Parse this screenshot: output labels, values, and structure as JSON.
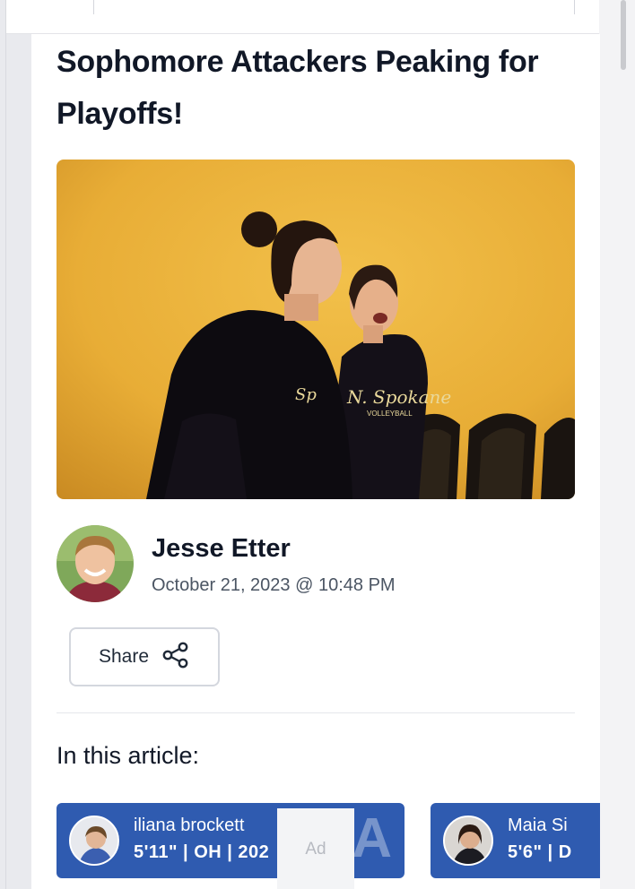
{
  "article": {
    "title": "Sophomore Attackers Peaking for Playoffs!",
    "hero_image_icon": "volleyball-players-photo",
    "jersey_text": "N. Spokane",
    "jersey_subtext": "VOLLEYBALL"
  },
  "author": {
    "name": "Jesse Etter",
    "date": "October 21, 2023 @ 10:48 PM",
    "avatar_icon": "author-avatar"
  },
  "share": {
    "label": "Share",
    "icon": "share-icon"
  },
  "section": {
    "in_article_label": "In this article:"
  },
  "players": [
    {
      "name": "iliana brockett",
      "meta": "5'11\" | OH | 202",
      "letter": "A",
      "photo_icon": "player-photo"
    },
    {
      "name": "Maia Si",
      "meta": "5'6\" | D",
      "letter": "",
      "photo_icon": "player-photo"
    }
  ],
  "ad": {
    "label": "Ad"
  },
  "colors": {
    "accent": "#2f5bb0",
    "title": "#111827",
    "hero_background": "#eab13c"
  }
}
